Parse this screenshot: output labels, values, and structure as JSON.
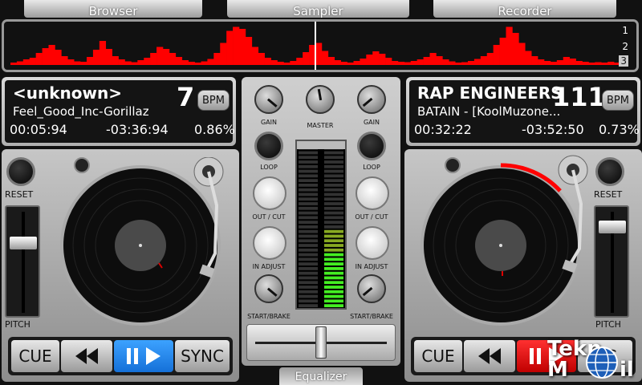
{
  "tabs": {
    "browser": "Browser",
    "sampler": "Sampler",
    "recorder": "Recorder",
    "equalizer": "Equalizer"
  },
  "waveform": {
    "markers": [
      "1",
      "2",
      "3"
    ],
    "selected_marker": "3",
    "peaks": [
      0.06,
      0.09,
      0.14,
      0.18,
      0.3,
      0.42,
      0.5,
      0.38,
      0.22,
      0.14,
      0.09,
      0.08,
      0.2,
      0.38,
      0.6,
      0.4,
      0.22,
      0.14,
      0.09,
      0.07,
      0.12,
      0.18,
      0.3,
      0.45,
      0.4,
      0.3,
      0.2,
      0.12,
      0.08,
      0.06,
      0.09,
      0.15,
      0.3,
      0.55,
      0.85,
      0.95,
      0.9,
      0.7,
      0.45,
      0.3,
      0.18,
      0.12,
      0.08,
      0.06,
      0.1,
      0.18,
      0.32,
      0.5,
      0.55,
      0.35,
      0.2,
      0.12,
      0.08,
      0.06,
      0.1,
      0.16,
      0.26,
      0.34,
      0.28,
      0.18,
      0.1,
      0.08,
      0.07,
      0.1,
      0.14,
      0.2,
      0.3,
      0.22,
      0.14,
      0.09,
      0.06,
      0.07,
      0.1,
      0.15,
      0.22,
      0.3,
      0.5,
      0.68,
      0.95,
      0.8,
      0.55,
      0.35,
      0.22,
      0.14,
      0.1,
      0.08,
      0.12,
      0.2,
      0.16,
      0.1,
      0.08,
      0.06,
      0.07,
      0.06,
      0.08,
      0.06
    ],
    "accent": "#ff0000",
    "playhead_fraction": 0.5
  },
  "deck_left": {
    "name": "<unknown>",
    "track": "Feel_Good_Inc-Gorillaz",
    "bpm": "7",
    "bpm_label": "BPM",
    "elapsed": "00:05:94",
    "remaining": "-03:36:94",
    "pitch": "0.86%",
    "reset_label": "RESET",
    "pitch_label": "PITCH",
    "cue": "CUE",
    "sync": "SYNC",
    "pitch_level": 0.28,
    "playing": true
  },
  "deck_right": {
    "name": "RAP ENGINEERS",
    "track": "BATAIN - [KoolMuzone...",
    "bpm": "111",
    "bpm_label": "BPM",
    "elapsed": "00:32:22",
    "remaining": "-03:52:50",
    "pitch": "0.73%",
    "reset_label": "RESET",
    "pitch_label": "PITCH",
    "cue": "CUE",
    "sync": "NC",
    "pitch_level": 0.1,
    "playing": true
  },
  "mixer": {
    "gain_left": "GAIN",
    "master": "MASTER",
    "gain_right": "GAIN",
    "loop_left": "LOOP",
    "loop_right": "LOOP",
    "outcut_left": "OUT / CUT",
    "outcut_right": "OUT / CUT",
    "inadjust_left": "IN ADJUST",
    "inadjust_right": "IN ADJUST",
    "startbrake_left": "START/BRAKE",
    "startbrake_right": "START/BRAKE",
    "meter_left_level": 0.0,
    "meter_right_level": 0.48,
    "crossfader_position": 0.5
  },
  "watermark": "TeknoMobil",
  "colors": {
    "accent_red": "#ff0000",
    "play_blue": "#1e90ff",
    "meter_green": "#44ee22"
  }
}
